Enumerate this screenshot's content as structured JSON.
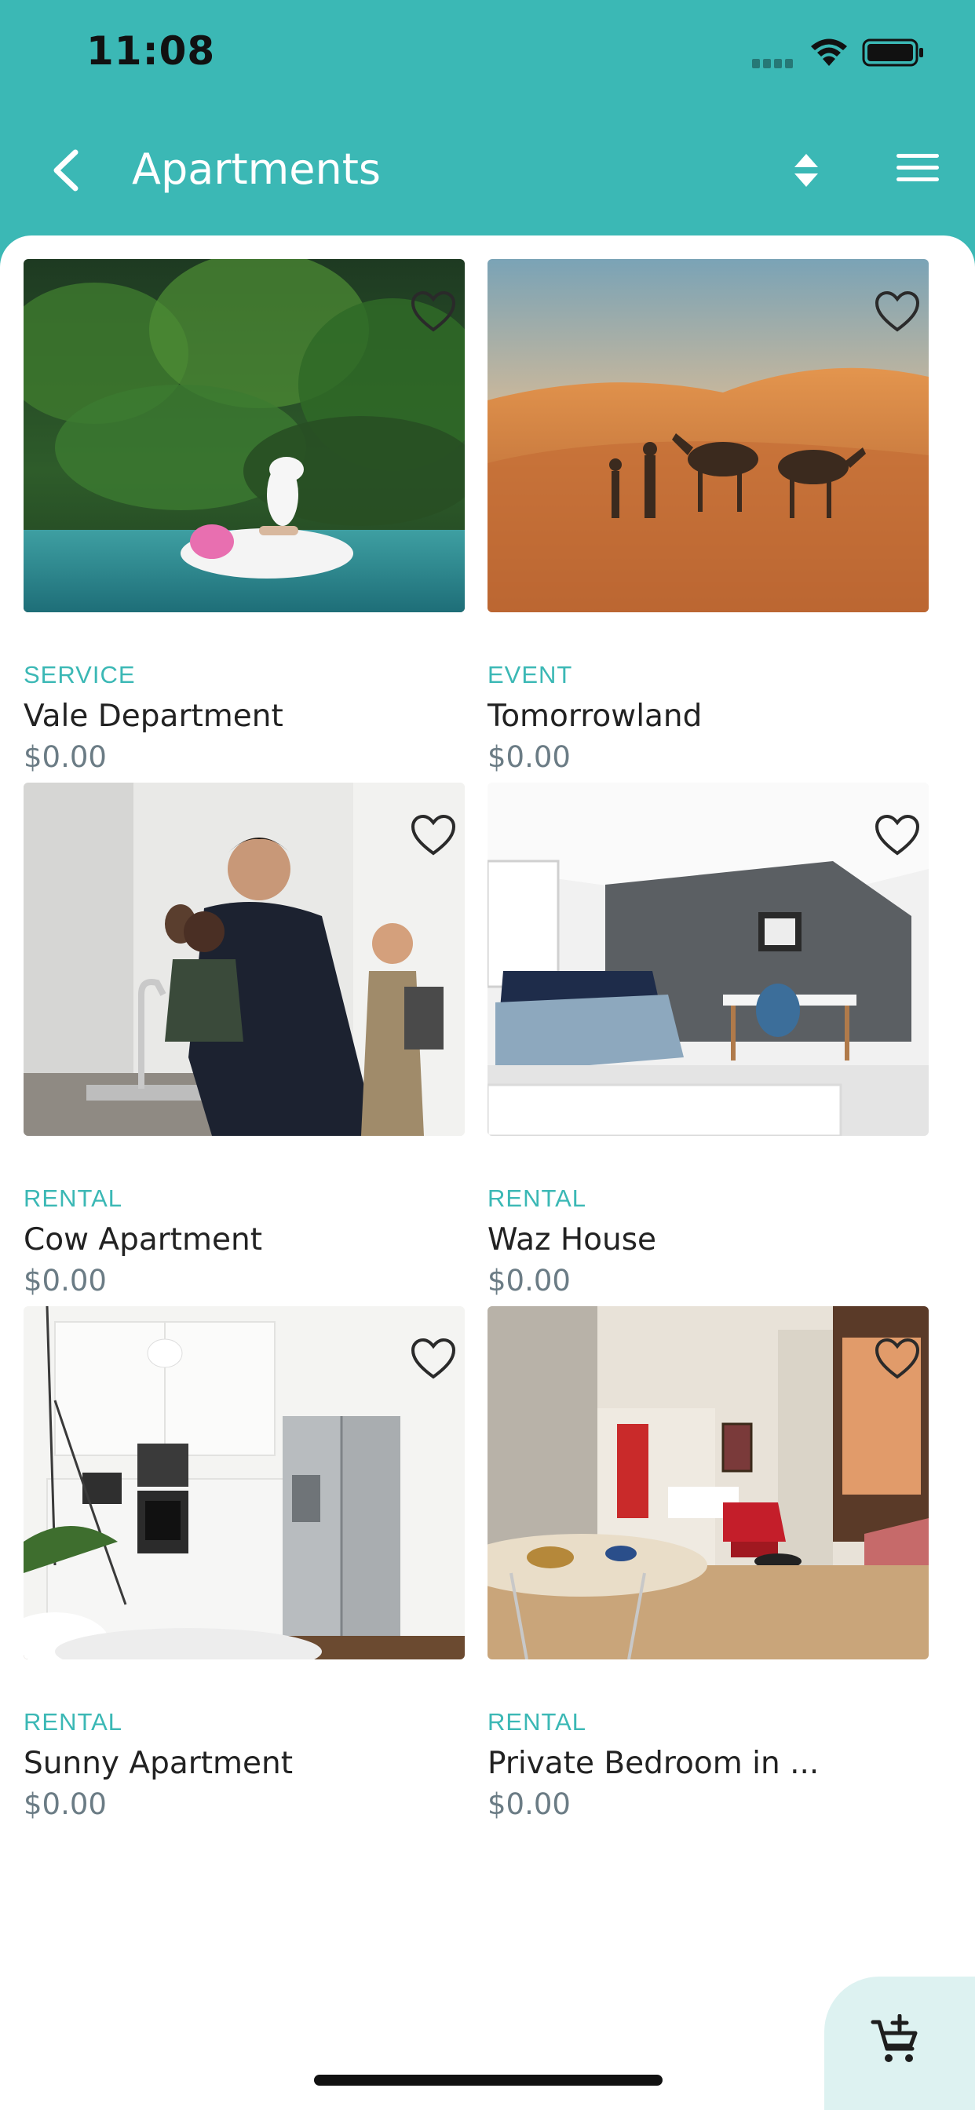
{
  "status_bar": {
    "time": "11:08"
  },
  "header": {
    "title": "Apartments",
    "back_icon": "chevron-left-icon",
    "sort_icon": "sort-icon",
    "menu_icon": "menu-icon"
  },
  "listings": [
    {
      "category": "SERVICE",
      "name": "Vale Department",
      "price": "$0.00",
      "image": "pool-unicorn-float"
    },
    {
      "category": "EVENT",
      "name": "Tomorrowland",
      "price": "$0.00",
      "image": "desert-camels"
    },
    {
      "category": "RENTAL",
      "name": "Cow Apartment",
      "price": "$0.00",
      "image": "kitchen-people"
    },
    {
      "category": "RENTAL",
      "name": "Waz House",
      "price": "$0.00",
      "image": "bedroom-grey-wall"
    },
    {
      "category": "RENTAL",
      "name": "Sunny Apartment",
      "price": "$0.00",
      "image": "white-kitchen-fridge"
    },
    {
      "category": "RENTAL",
      "name": "Private Bedroom in ...",
      "price": "$0.00",
      "image": "living-room-red-chair"
    }
  ],
  "colors": {
    "accent": "#3BB8B5",
    "price": "#6B7C85",
    "fab_bg": "#DDF2F1"
  },
  "fab": {
    "icon": "add-to-cart-icon"
  }
}
